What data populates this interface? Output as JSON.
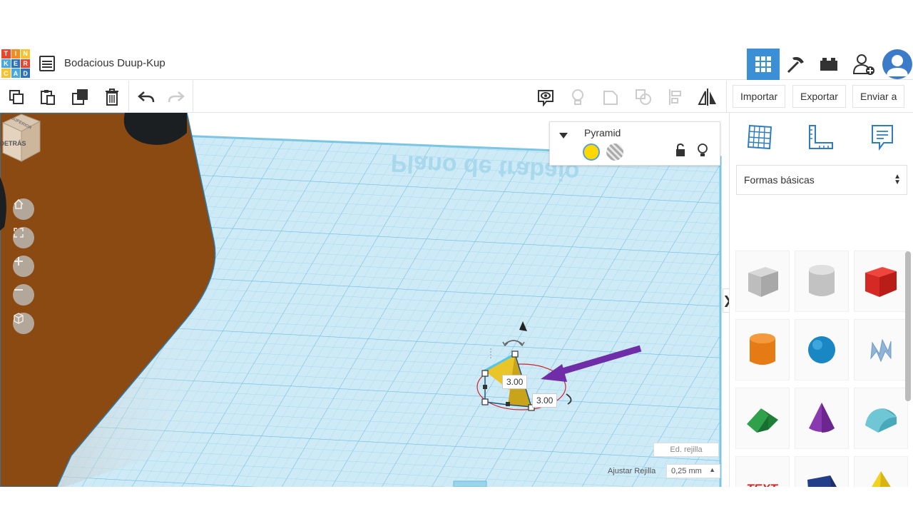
{
  "header": {
    "logo_letters": [
      "T",
      "I",
      "N",
      "K",
      "E",
      "R",
      "C",
      "A",
      "D"
    ],
    "logo_colors": [
      "#e8462f",
      "#f18c24",
      "#f7c230",
      "#49a9dc",
      "#2e73b8",
      "#e8462f",
      "#f7c230",
      "#49a9dc",
      "#2e73b8"
    ],
    "title": "Bodacious Duup-Kup",
    "buttons": [
      "grid-view-icon",
      "pickaxe-icon",
      "bricks-icon",
      "add-user-icon"
    ],
    "accent": "#3b8fd6"
  },
  "toolbar": {
    "import_label": "Importar",
    "export_label": "Exportar",
    "send_label": "Enviar a"
  },
  "workplane": {
    "plane_text": "Plano de trabajo",
    "viewcube_front": "DETRÁS",
    "viewcube_top": "SUPERIOR",
    "dimension_a": "3.00",
    "dimension_b": "3.00",
    "grid_edit_label": "Ed. rejilla",
    "snap_label": "Ajustar Rejilla",
    "snap_value": "0,25 mm",
    "panel_toggle": "❯"
  },
  "inspector": {
    "title": "Pyramid",
    "solid_color": "#ffd800"
  },
  "library": {
    "selected": "Formas básicas",
    "shapes": [
      "box-hole",
      "cylinder-hole",
      "box",
      "cylinder",
      "sphere",
      "scribble",
      "roof",
      "cone",
      "round-roof",
      "text",
      "polygon",
      "pyramid"
    ]
  }
}
